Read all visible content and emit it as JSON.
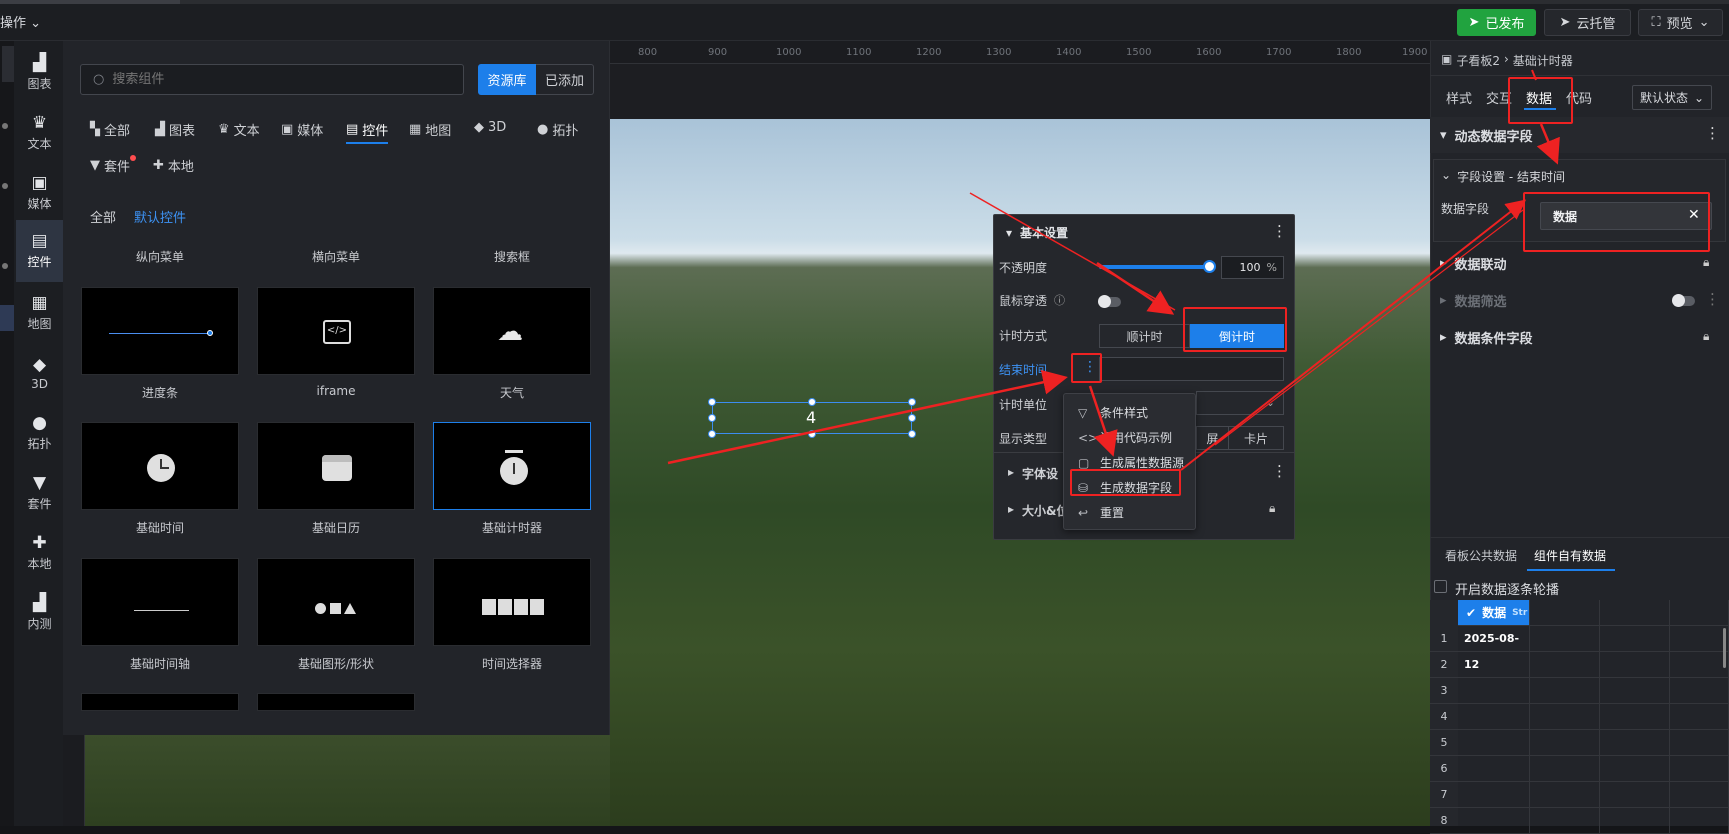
{
  "topbar": {
    "op_label": "操作",
    "publish": "已发布",
    "cloud_host": "云托管",
    "preview": "预览"
  },
  "leftnav": [
    "图表",
    "文本",
    "媒体",
    "控件",
    "地图",
    "3D",
    "拓扑",
    "套件",
    "本地",
    "内测"
  ],
  "panel": {
    "search_placeholder": "搜索组件",
    "tab_library": "资源库",
    "tab_added": "已添加",
    "categories": [
      "全部",
      "图表",
      "文本",
      "媒体",
      "控件",
      "地图",
      "3D",
      "拓扑",
      "套件",
      "本地"
    ],
    "sub": {
      "all": "全部",
      "default": "默认控件"
    },
    "col_headers": [
      "纵向菜单",
      "横向菜单",
      "搜索框"
    ],
    "tiles": [
      "进度条",
      "iframe",
      "天气",
      "基础时间",
      "基础日历",
      "基础计时器",
      "基础时间轴",
      "基础图形/形状",
      "时间选择器"
    ]
  },
  "ruler_ticks": [
    "800",
    "900",
    "1000",
    "1100",
    "1200",
    "1300",
    "1400",
    "1500",
    "1600",
    "1700",
    "1800",
    "1900"
  ],
  "widget_value": "4",
  "popup": {
    "title": "基本设置",
    "opacity_label": "不透明度",
    "opacity_value": "100",
    "opacity_unit": "%",
    "mouse_through_label": "鼠标穿透",
    "mode_label": "计时方式",
    "mode_up": "顺计时",
    "mode_down": "倒计时",
    "end_time_label": "结束时间",
    "unit_label": "计时单位",
    "display_label": "显示类型",
    "display_screen_fragment": "屏",
    "display_card": "卡片",
    "font_label": "字体设",
    "size_label": "大小&位"
  },
  "context_menu": [
    "条件样式",
    "调用代码示例",
    "生成属性数据源",
    "生成数据字段",
    "重置"
  ],
  "rpanel": {
    "breadcrumb_parent": "子看板2",
    "breadcrumb_current": "基础计时器",
    "tabs": [
      "样式",
      "交互",
      "数据",
      "代码"
    ],
    "state_select": "默认状态",
    "sections": {
      "dynamic": "动态数据字段",
      "field_settings": "字段设置 - 结束时间",
      "data_field_label": "数据字段",
      "data_field_value": "数据",
      "linkage": "数据联动",
      "filter": "数据筛选",
      "conditional": "数据条件字段"
    },
    "bottom_tabs": [
      "看板公共数据",
      "组件自有数据"
    ],
    "carousel_label": "开启数据逐条轮播",
    "column_header": "数据",
    "column_type": "Str",
    "rows": [
      "1",
      "2",
      "3",
      "4",
      "5",
      "6",
      "7",
      "8"
    ],
    "first_value": "2025-08-12"
  },
  "colors": {
    "accent": "#1d7fea",
    "publish_green": "#21a33f",
    "annotation_red": "#ee2222"
  }
}
